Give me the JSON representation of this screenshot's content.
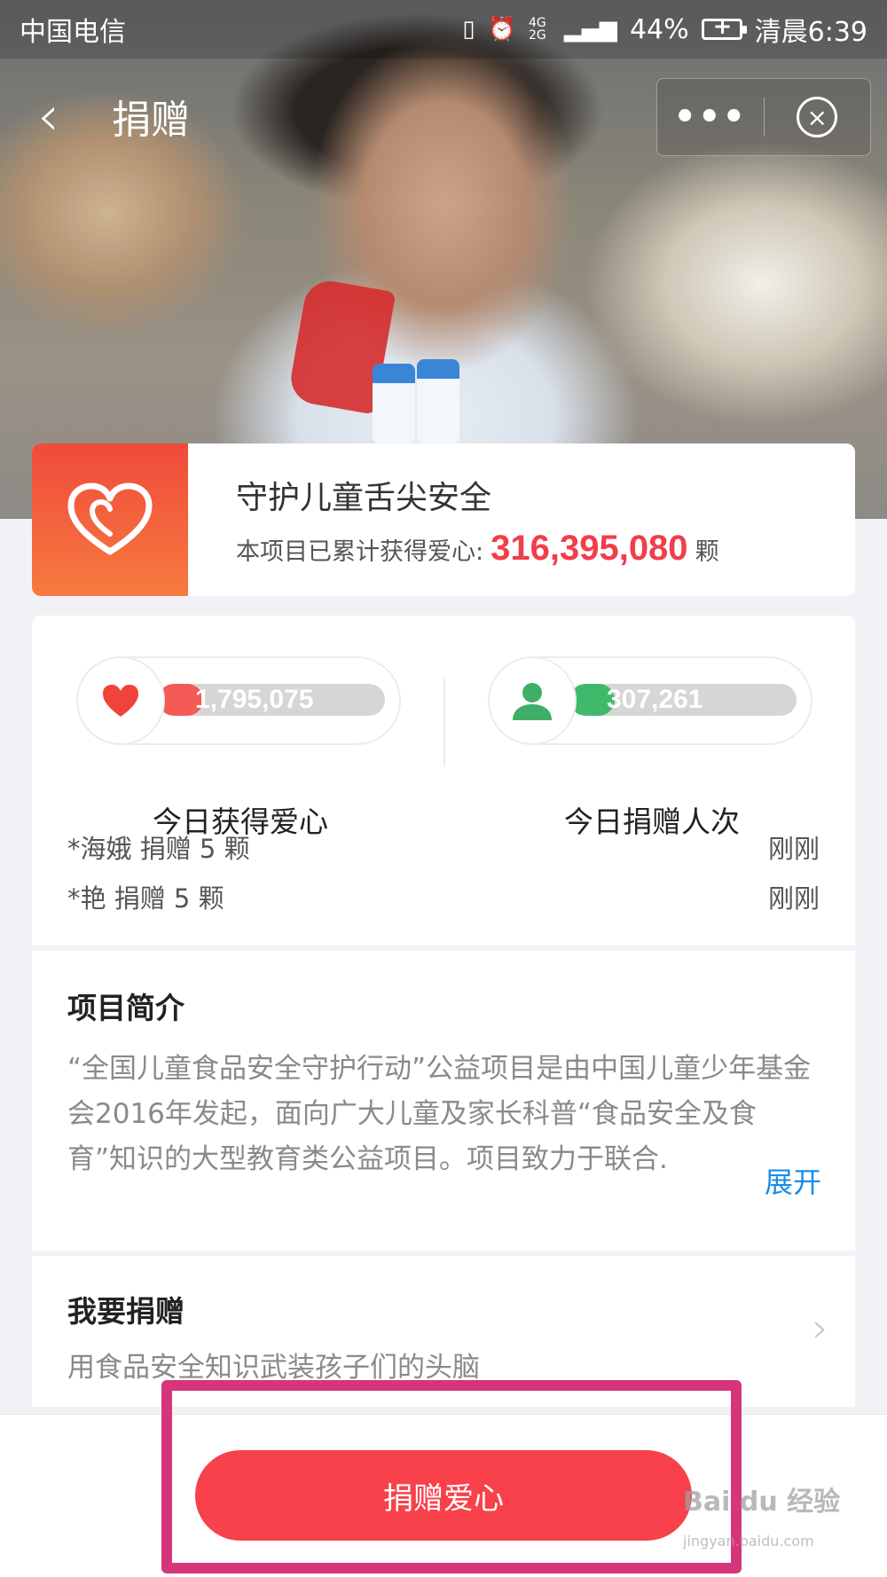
{
  "status_bar": {
    "carrier": "中国电信",
    "network": "4G 2G",
    "battery": "44%",
    "time": "清晨6:39"
  },
  "header": {
    "title": "捐赠",
    "icons": [
      "back-icon",
      "more-icon",
      "close-icon"
    ]
  },
  "project": {
    "name": "守护儿童舌尖安全",
    "total_label": "本项目已累计获得爱心:",
    "total_value": "316,395,080",
    "total_unit": "颗"
  },
  "stats": {
    "hearts_today": {
      "value": "1,795,075",
      "label": "今日获得爱心",
      "fill_fraction": 0.2,
      "color": "#f45a56",
      "icon": "heart-icon"
    },
    "donors_today": {
      "value": "307,261",
      "label": "今日捐赠人次",
      "fill_fraction": 0.2,
      "color": "#3fba6b",
      "icon": "person-icon"
    }
  },
  "donations": [
    {
      "text": "*海娥 捐赠 5 颗",
      "time": "刚刚"
    },
    {
      "text": "*艳 捐赠 5 颗",
      "time": "刚刚"
    }
  ],
  "intro": {
    "title": "项目简介",
    "text": "“全国儿童食品安全守护行动”公益项目是由中国儿童少年基金会2016年发起，面向广大儿童及家长科普“食品安全及食育”知识的大型教育类公益项目。项目致力于联合.",
    "expand_label": "展开"
  },
  "donate_section": {
    "title": "我要捐赠",
    "subtitle": "用食品安全知识武装孩子们的头脑"
  },
  "bottom": {
    "button_label": "捐赠爱心"
  },
  "watermark": {
    "main": "Bai du 经验",
    "sub": "jingyan.baidu.com"
  },
  "colors": {
    "accent_red": "#f8414b",
    "number_red": "#f23d4a",
    "link_blue": "#1a8ce6",
    "highlight": "#d6357b"
  }
}
